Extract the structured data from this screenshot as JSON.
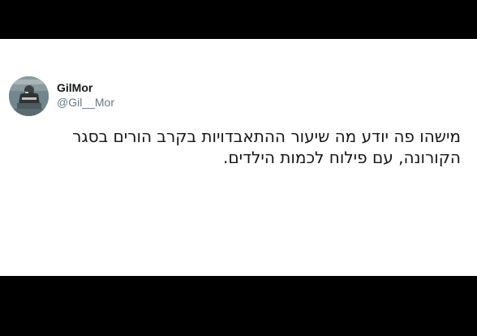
{
  "tweet": {
    "author": {
      "display_name": "GilMor",
      "handle": "@Gil__Mor",
      "avatar_icon": "profile-photo"
    },
    "text": "מישהו פה יודע מה שיעור ההתאבדויות בקרב הורים בסגר הקורונה, עם פילוח לכמות הילדים."
  },
  "colors": {
    "background": "#000000",
    "card": "#ffffff",
    "text": "#14171a",
    "handle": "#657786"
  }
}
